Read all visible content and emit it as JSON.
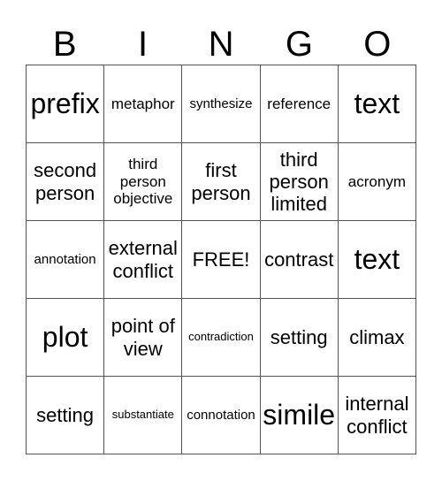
{
  "header": [
    "B",
    "I",
    "N",
    "G",
    "O"
  ],
  "cells": [
    {
      "text": "prefix",
      "size": "s1"
    },
    {
      "text": "metaphor",
      "size": "s3"
    },
    {
      "text": "synthesize",
      "size": "s4"
    },
    {
      "text": "reference",
      "size": "s3"
    },
    {
      "text": "text",
      "size": "s1"
    },
    {
      "text": "second person",
      "size": "s2"
    },
    {
      "text": "third person objective",
      "size": "s3"
    },
    {
      "text": "first person",
      "size": "s2"
    },
    {
      "text": "third person limited",
      "size": "s2"
    },
    {
      "text": "acronym",
      "size": "s3"
    },
    {
      "text": "annotation",
      "size": "s4"
    },
    {
      "text": "external conflict",
      "size": "s2"
    },
    {
      "text": "FREE!",
      "size": "s2"
    },
    {
      "text": "contrast",
      "size": "s2"
    },
    {
      "text": "text",
      "size": "s1"
    },
    {
      "text": "plot",
      "size": "s1"
    },
    {
      "text": "point of view",
      "size": "s2"
    },
    {
      "text": "contradiction",
      "size": "s5"
    },
    {
      "text": "setting",
      "size": "s2"
    },
    {
      "text": "climax",
      "size": "s2"
    },
    {
      "text": "setting",
      "size": "s2"
    },
    {
      "text": "substantiate",
      "size": "s5"
    },
    {
      "text": "connotation",
      "size": "s4"
    },
    {
      "text": "simile",
      "size": "s1"
    },
    {
      "text": "internal conflict",
      "size": "s2"
    }
  ]
}
